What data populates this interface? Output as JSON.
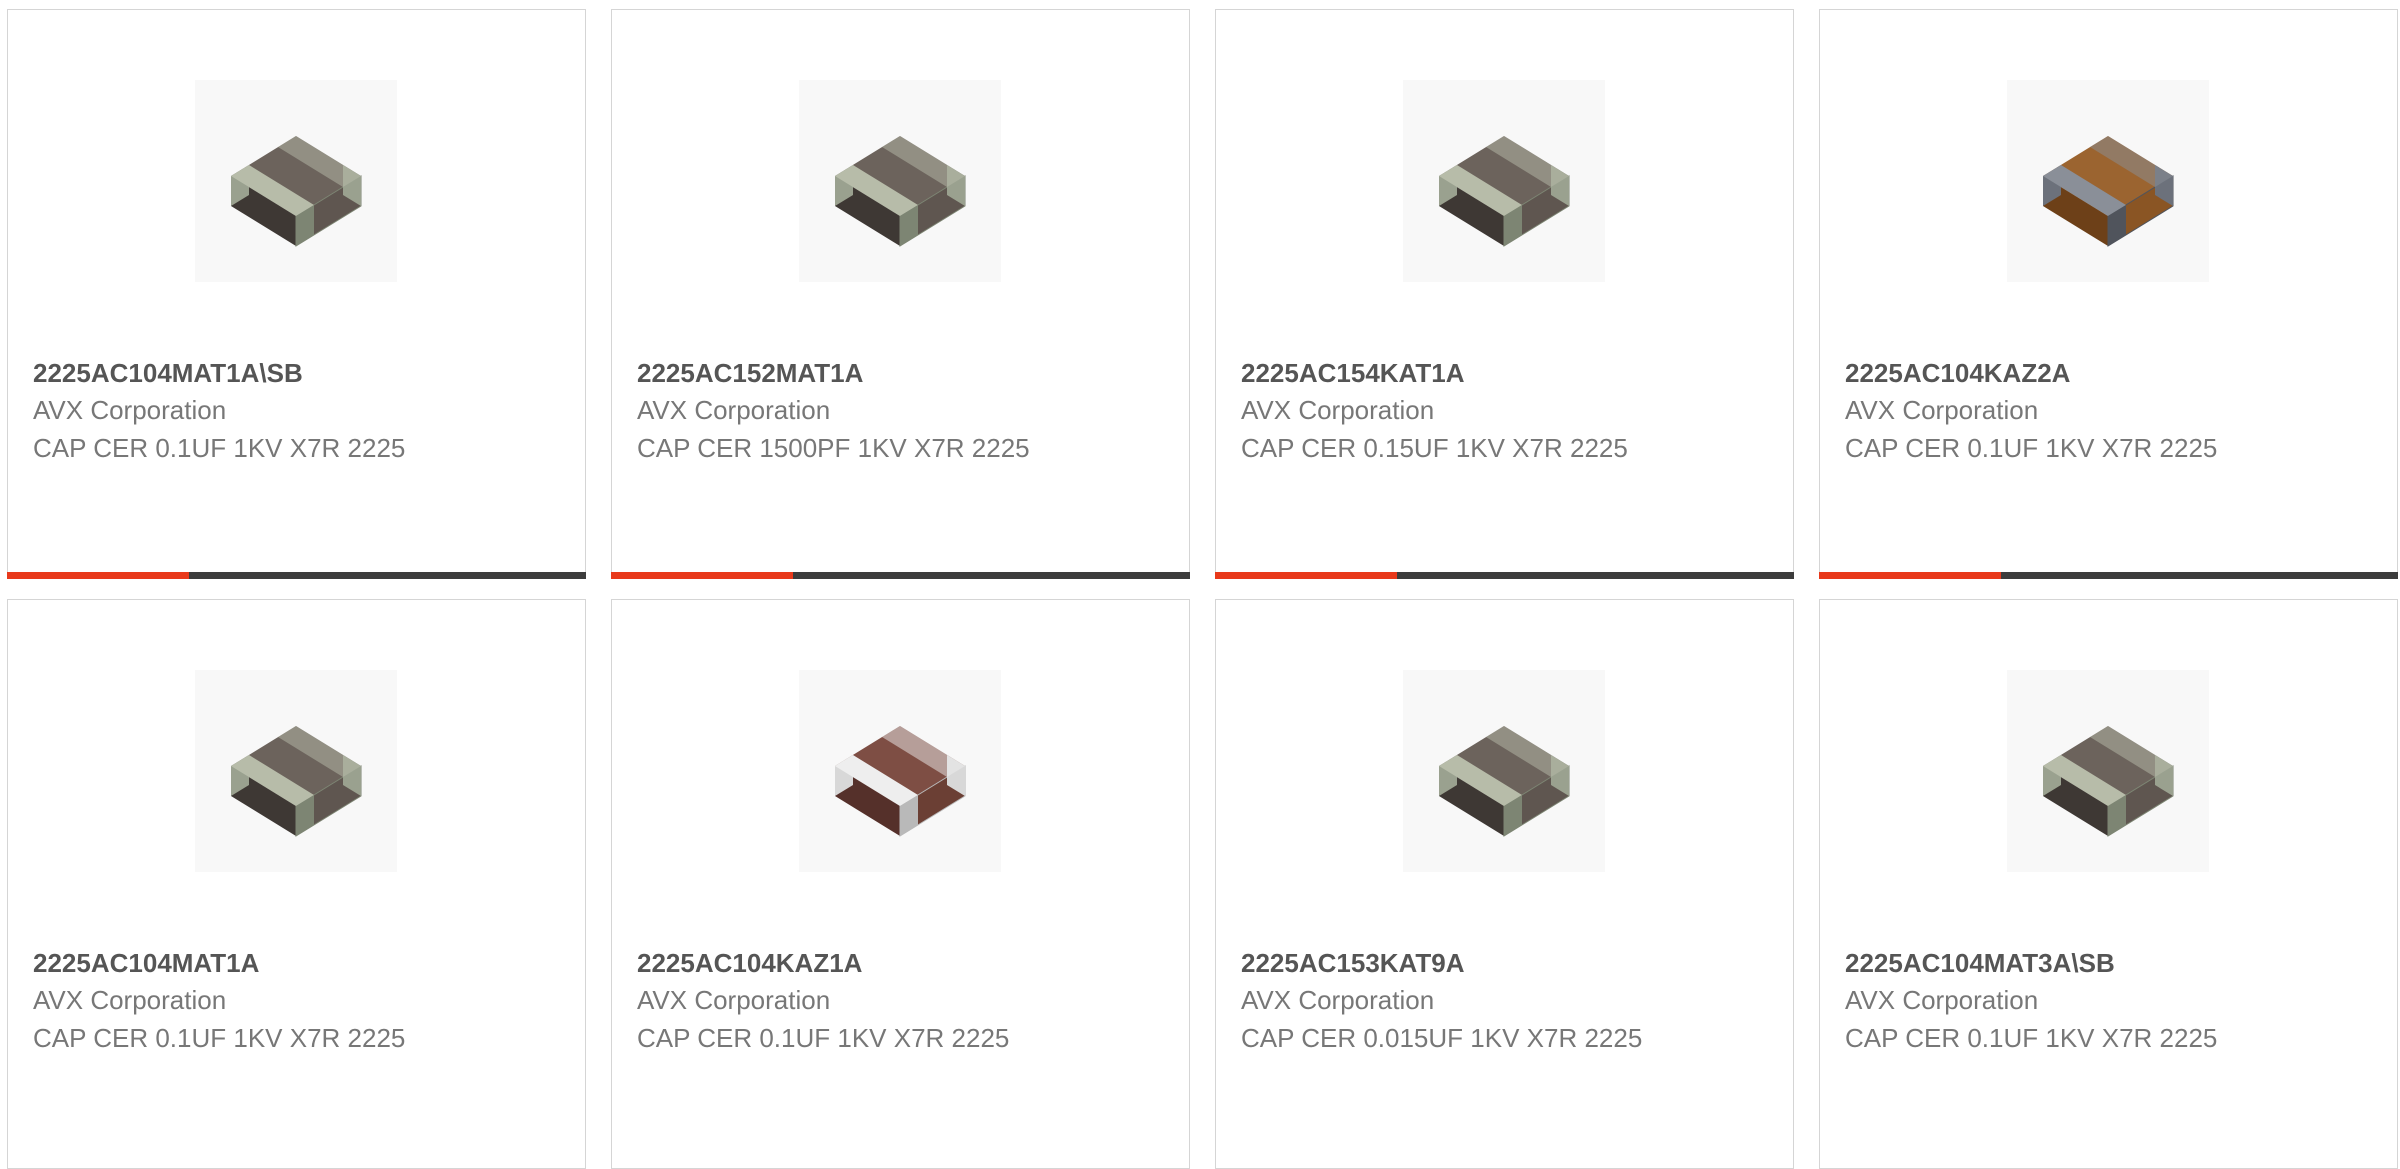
{
  "products": [
    {
      "part_number": "2225AC104MAT1A\\SB",
      "manufacturer": "AVX Corporation",
      "description": "CAP CER 0.1UF 1KV X7R 2225",
      "image": "ceramic-capacitor-gray-icon",
      "progress": 0.315
    },
    {
      "part_number": "2225AC152MAT1A",
      "manufacturer": "AVX Corporation",
      "description": "CAP CER 1500PF 1KV X7R 2225",
      "image": "ceramic-capacitor-gray-icon",
      "progress": 0.315
    },
    {
      "part_number": "2225AC154KAT1A",
      "manufacturer": "AVX Corporation",
      "description": "CAP CER 0.15UF 1KV X7R 2225",
      "image": "ceramic-capacitor-gray-icon",
      "progress": 0.315
    },
    {
      "part_number": "2225AC104KAZ2A",
      "manufacturer": "AVX Corporation",
      "description": "CAP CER 0.1UF 1KV X7R 2225",
      "image": "ceramic-capacitor-brown-icon",
      "progress": 0.315
    },
    {
      "part_number": "2225AC104MAT1A",
      "manufacturer": "AVX Corporation",
      "description": "CAP CER 0.1UF 1KV X7R 2225",
      "image": "ceramic-capacitor-gray-icon"
    },
    {
      "part_number": "2225AC104KAZ1A",
      "manufacturer": "AVX Corporation",
      "description": "CAP CER 0.1UF 1KV X7R 2225",
      "image": "ceramic-capacitor-brown-silver-icon"
    },
    {
      "part_number": "2225AC153KAT9A",
      "manufacturer": "AVX Corporation",
      "description": "CAP CER 0.015UF 1KV X7R 2225",
      "image": "ceramic-capacitor-gray-icon"
    },
    {
      "part_number": "2225AC104MAT3A\\SB",
      "manufacturer": "AVX Corporation",
      "description": "CAP CER 0.1UF 1KV X7R 2225",
      "image": "ceramic-capacitor-gray-icon"
    }
  ],
  "colors": {
    "accent": "#e8391b",
    "bar_track": "#3c3c3c",
    "card_border": "#d5d5d5",
    "title_text": "#555555",
    "body_text": "#777777"
  }
}
